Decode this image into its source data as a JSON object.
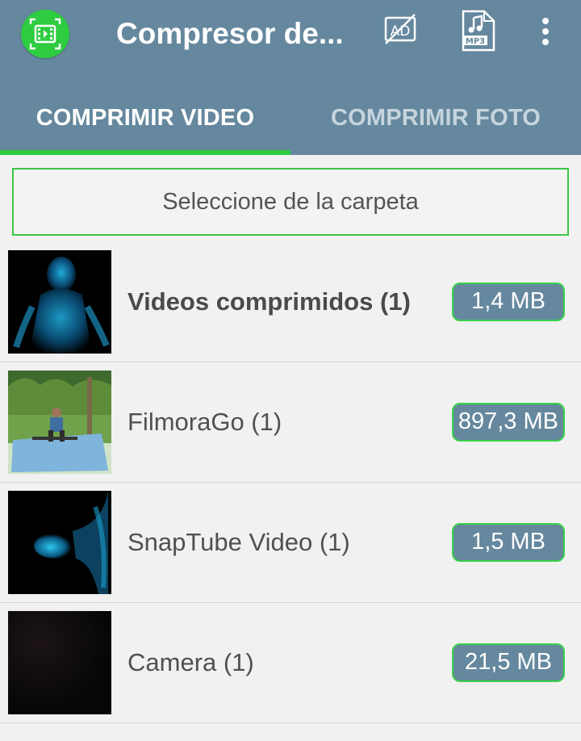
{
  "appbar": {
    "title": "Compresor de...",
    "logo_icon": "video-compress-logo-icon",
    "actions": [
      {
        "name": "no-ads-icon"
      },
      {
        "name": "mp3-file-icon",
        "label": "MP3"
      },
      {
        "name": "more-vert-icon"
      }
    ],
    "colors": {
      "bar": "#65889e",
      "accent": "#2ecc40"
    }
  },
  "tabs": [
    {
      "label": "COMPRIMIR VIDEO",
      "active": true
    },
    {
      "label": "COMPRIMIR FOTO",
      "active": false
    }
  ],
  "select_folder": {
    "label": "Seleccione de la carpeta"
  },
  "folders": [
    {
      "label": "Videos comprimidos (1)",
      "size": "1,4 MB",
      "bold": true
    },
    {
      "label": "FilmoraGo (1)",
      "size": "897,3 MB",
      "bold": false
    },
    {
      "label": "SnapTube Video (1)",
      "size": "1,5 MB",
      "bold": false
    },
    {
      "label": "Camera (1)",
      "size": "21,5 MB",
      "bold": false
    }
  ]
}
